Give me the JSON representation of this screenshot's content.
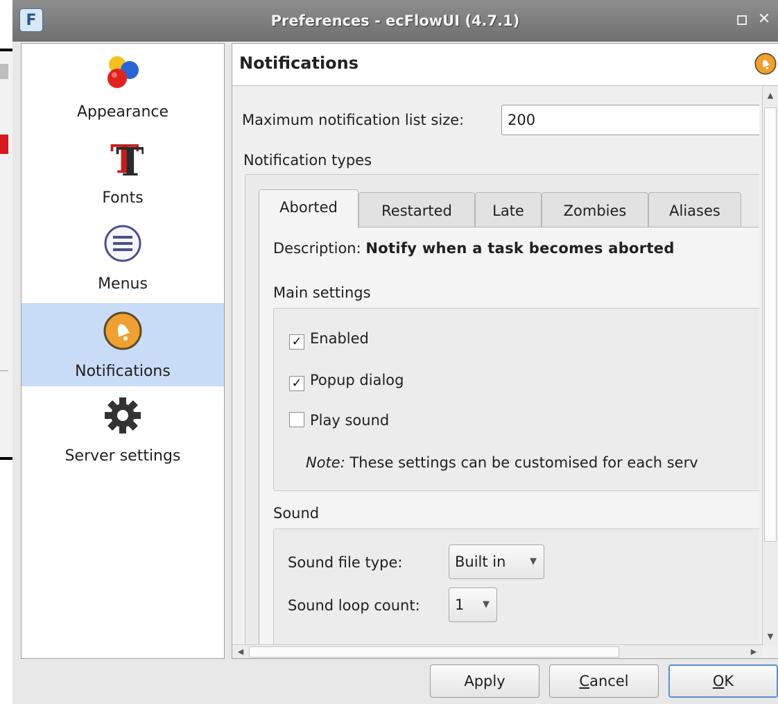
{
  "window": {
    "title": "Preferences - ecFlowUI (4.7.1)",
    "logo_letter": "F",
    "close_glyph": "✕"
  },
  "categories": [
    {
      "label": "Appearance",
      "icon": "appearance-balls-icon"
    },
    {
      "label": "Fonts",
      "icon": "fonts-icon",
      "glyph": "T"
    },
    {
      "label": "Menus",
      "icon": "menus-icon"
    },
    {
      "label": "Notifications",
      "icon": "bell-icon",
      "selected": true
    },
    {
      "label": "Server settings",
      "icon": "gear-icon"
    }
  ],
  "page": {
    "title": "Notifications",
    "max_list_label": "Maximum notification list size:",
    "max_list_value": "200",
    "types_label": "Notification types",
    "tabs": [
      "Aborted",
      "Restarted",
      "Late",
      "Zombies",
      "Aliases"
    ],
    "active_tab": "Aborted",
    "description_prefix": "Description:",
    "description_text": "Notify when a task becomes aborted",
    "main_settings_label": "Main settings",
    "checkboxes": [
      {
        "label": "Enabled",
        "checked": true
      },
      {
        "label": "Popup dialog",
        "checked": true
      },
      {
        "label": "Play sound",
        "checked": false
      }
    ],
    "check_mark": "✓",
    "note_prefix": "Note:",
    "note_text": "These settings can be customised for each serv",
    "sound_label": "Sound",
    "sound_file_type_label": "Sound file type:",
    "sound_file_type_value": "Built in",
    "sound_loop_label": "Sound loop count:",
    "sound_loop_value": "1",
    "dropdown_glyph": "▼"
  },
  "scroll": {
    "up": "▲",
    "down": "▼",
    "left": "◀",
    "right": "▶"
  },
  "buttons": {
    "apply": "Apply",
    "cancel_first": "C",
    "cancel_rest": "ancel",
    "ok_first": "O",
    "ok_rest": "K"
  },
  "colors": {
    "selection": "#c9dcf7",
    "bell_orange": "#f0a030",
    "default_button_border": "#5a8fd3"
  }
}
